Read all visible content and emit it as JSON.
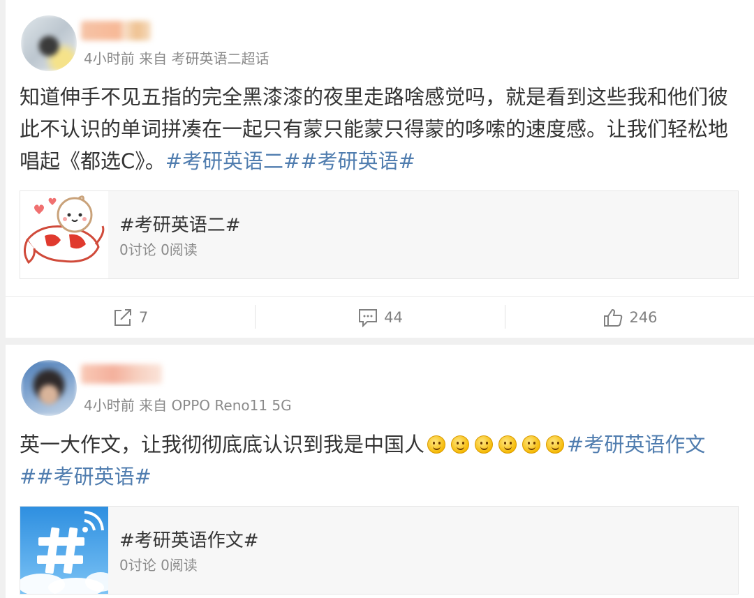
{
  "posts": [
    {
      "meta": "4小时前 来自 考研英语二超话",
      "content_text": "知道伸手不见五指的完全黑漆漆的夜里走路啥感觉吗，就是看到这些我和他们彼此不认识的单词拼凑在一起只有蒙只能蒙只得蒙的哆嗦的速度感。让我们轻松地唱起《都选C》。",
      "content_tags": "#考研英语二##考研英语#",
      "card": {
        "title": "#考研英语二#",
        "subtitle": "0讨论 0阅读",
        "thumb_icon": "koi-fish-cartoon-icon"
      },
      "actions": {
        "repost_count": "7",
        "comment_count": "44",
        "like_count": "246"
      }
    },
    {
      "meta": "4小时前 来自 OPPO Reno11 5G",
      "content_text": "英一大作文，让我彻彻底底认识到我是中国人",
      "emoji_icon": "smile-emoji-icon",
      "content_tags_1": "#考研英语作文",
      "content_tags_2": "##考研英语#",
      "card": {
        "title": "#考研英语作文#",
        "subtitle": "0讨论 0阅读",
        "thumb_icon": "hashtag-topic-icon"
      }
    }
  ],
  "colors": {
    "tag": "#507daf",
    "meta": "#8a8a8a",
    "card_bg": "#f7f7f7"
  }
}
